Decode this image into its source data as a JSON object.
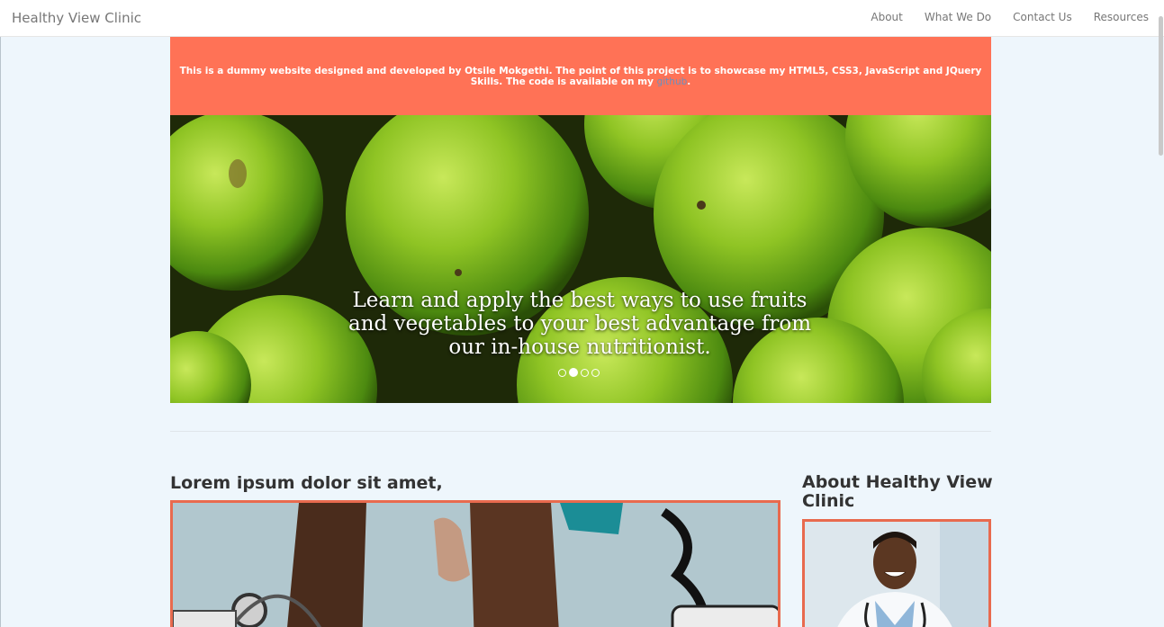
{
  "navbar": {
    "brand": "Healthy View Clinic",
    "links": [
      "About",
      "What We Do",
      "Contact Us",
      "Resources"
    ]
  },
  "banner": {
    "text": "This is a dummy website designed and developed by Otsile Mokgethi. The point of this project is to showcase my HTML5, CSS3, JavaScript and JQuery Skills. The code is available on my ",
    "link_text": "github",
    "suffix": "."
  },
  "carousel": {
    "caption": "Learn and apply the best ways to use fruits and vegetables to your best advantage from our in-house nutritionist.",
    "slide_count": 4,
    "active_slide": 2
  },
  "main": {
    "article_title": "Lorem ipsum dolor sit amet,",
    "aside_title": "About Healthy View Clinic"
  },
  "colors": {
    "banner": "#ff7256",
    "frame": "#e86a4e",
    "background": "#eef6fc"
  }
}
